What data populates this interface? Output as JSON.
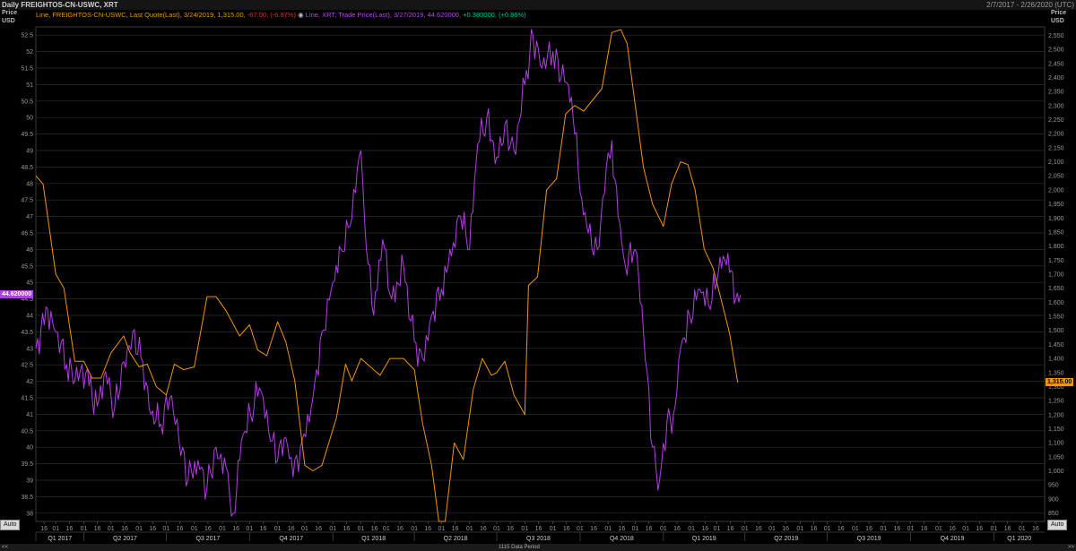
{
  "header": {
    "title": "Daily FREIGHTOS-CN-USWC, XRT",
    "date_range": "2/7/2017 - 2/26/2020 (UTC)"
  },
  "legend": {
    "series1": {
      "prefix": "Line, FREIGHTOS-CN-USWC, Last Quote(Last),  3/24/2019,  1,315.00,",
      "change": "-67.00,  (-6.87%)"
    },
    "series2": {
      "text": "Line, XRT, Trade Price(Last),  3/27/2019,  44.620000,",
      "change": "+0.380000,  (+0.86%)"
    }
  },
  "axes": {
    "left_title": [
      "Price",
      "USD"
    ],
    "right_title": [
      "Price",
      "USD"
    ],
    "left_badge": "44.620000",
    "right_badge": "1,315.00",
    "auto_left": "Auto",
    "auto_right": "Auto"
  },
  "footer": {
    "data_period": "1115 Data Period",
    "nav_left": "<<",
    "nav_right": ">>"
  },
  "colors": {
    "xrt": "#b23ee6",
    "freight": "#f0960a",
    "background": "#000000",
    "grid": "#2e2e2e",
    "change_negative": "#e03030",
    "change_positive": "#00c8a0"
  },
  "chart_data": {
    "type": "line",
    "x_range": [
      "2017-02-07",
      "2020-02-26"
    ],
    "quarters": [
      "Q1 2017",
      "Q2 2017",
      "Q3 2017",
      "Q4 2017",
      "Q1 2018",
      "Q2 2018",
      "Q3 2018",
      "Q4 2018",
      "Q1 2019",
      "Q2 2019",
      "Q3 2019",
      "Q4 2019",
      "Q1 2020"
    ],
    "left_axis": {
      "label": "Price USD",
      "ylim": [
        37.75,
        52.75
      ],
      "ticks": [
        "38",
        "38.5",
        "39",
        "39.5",
        "40",
        "40.5",
        "41",
        "41.5",
        "42",
        "42.5",
        "43",
        "43.5",
        "44",
        "44.5",
        "45",
        "45.5",
        "46",
        "46.5",
        "47",
        "47.5",
        "48",
        "48.5",
        "49",
        "49.5",
        "50",
        "50.5",
        "51",
        "51.5",
        "52",
        "52.5"
      ]
    },
    "right_axis": {
      "label": "Price USD",
      "ylim": [
        820,
        2580
      ],
      "ticks": [
        "850",
        "900",
        "950",
        "1,000",
        "1,050",
        "1,100",
        "1,150",
        "1,200",
        "1,250",
        "1,300",
        "1,350",
        "1,400",
        "1,450",
        "1,500",
        "1,550",
        "1,600",
        "1,650",
        "1,700",
        "1,750",
        "1,800",
        "1,850",
        "1,900",
        "1,950",
        "2,000",
        "2,050",
        "2,100",
        "2,150",
        "2,200",
        "2,250",
        "2,300",
        "2,350",
        "2,400",
        "2,450",
        "2,500",
        "2,550"
      ]
    },
    "series": [
      {
        "name": "XRT",
        "axis": "left",
        "points": [
          [
            "2017-02-07",
            43.0
          ],
          [
            "2017-02-20",
            44.2
          ],
          [
            "2017-03-01",
            43.5
          ],
          [
            "2017-03-13",
            42.5
          ],
          [
            "2017-03-22",
            42.0
          ],
          [
            "2017-04-05",
            42.4
          ],
          [
            "2017-04-12",
            41.0
          ],
          [
            "2017-04-25",
            42.3
          ],
          [
            "2017-05-05",
            41.2
          ],
          [
            "2017-05-15",
            42.6
          ],
          [
            "2017-05-25",
            43.5
          ],
          [
            "2017-06-05",
            42.6
          ],
          [
            "2017-06-14",
            41.0
          ],
          [
            "2017-06-25",
            40.7
          ],
          [
            "2017-07-05",
            41.5
          ],
          [
            "2017-07-15",
            40.2
          ],
          [
            "2017-07-25",
            39.0
          ],
          [
            "2017-08-05",
            39.6
          ],
          [
            "2017-08-15",
            38.8
          ],
          [
            "2017-08-25",
            40.0
          ],
          [
            "2017-09-05",
            39.4
          ],
          [
            "2017-09-13",
            38.0
          ],
          [
            "2017-09-22",
            40.2
          ],
          [
            "2017-10-02",
            41.0
          ],
          [
            "2017-10-12",
            41.8
          ],
          [
            "2017-10-22",
            40.5
          ],
          [
            "2017-11-01",
            39.6
          ],
          [
            "2017-11-10",
            40.3
          ],
          [
            "2017-11-18",
            39.1
          ],
          [
            "2017-11-28",
            40.2
          ],
          [
            "2017-12-10",
            41.5
          ],
          [
            "2017-12-20",
            43.5
          ],
          [
            "2018-01-01",
            45.0
          ],
          [
            "2018-01-10",
            46.0
          ],
          [
            "2018-01-20",
            46.7
          ],
          [
            "2018-02-01",
            49.0
          ],
          [
            "2018-02-07",
            46.0
          ],
          [
            "2018-02-15",
            44.0
          ],
          [
            "2018-02-25",
            46.3
          ],
          [
            "2018-03-07",
            44.5
          ],
          [
            "2018-03-20",
            45.5
          ],
          [
            "2018-04-01",
            43.2
          ],
          [
            "2018-04-10",
            42.7
          ],
          [
            "2018-04-20",
            44.0
          ],
          [
            "2018-05-01",
            44.8
          ],
          [
            "2018-05-12",
            45.8
          ],
          [
            "2018-05-22",
            47.0
          ],
          [
            "2018-06-01",
            46.0
          ],
          [
            "2018-06-10",
            49.2
          ],
          [
            "2018-06-20",
            50.0
          ],
          [
            "2018-07-01",
            48.8
          ],
          [
            "2018-07-10",
            49.8
          ],
          [
            "2018-07-20",
            49.0
          ],
          [
            "2018-08-01",
            51.0
          ],
          [
            "2018-08-10",
            52.5
          ],
          [
            "2018-08-20",
            51.5
          ],
          [
            "2018-09-01",
            52.0
          ],
          [
            "2018-09-10",
            51.2
          ],
          [
            "2018-09-18",
            51.0
          ],
          [
            "2018-09-25",
            49.5
          ],
          [
            "2018-10-03",
            47.5
          ],
          [
            "2018-10-10",
            46.5
          ],
          [
            "2018-10-20",
            46.0
          ],
          [
            "2018-10-30",
            48.5
          ],
          [
            "2018-11-05",
            49.3
          ],
          [
            "2018-11-12",
            47.0
          ],
          [
            "2018-11-20",
            45.5
          ],
          [
            "2018-12-01",
            46.0
          ],
          [
            "2018-12-10",
            43.5
          ],
          [
            "2018-12-20",
            40.0
          ],
          [
            "2018-12-26",
            38.7
          ],
          [
            "2019-01-05",
            40.8
          ],
          [
            "2019-01-12",
            41.0
          ],
          [
            "2019-01-20",
            43.0
          ],
          [
            "2019-01-30",
            44.0
          ],
          [
            "2019-02-10",
            44.8
          ],
          [
            "2019-02-20",
            44.3
          ],
          [
            "2019-03-01",
            45.0
          ],
          [
            "2019-03-08",
            45.8
          ],
          [
            "2019-03-15",
            45.3
          ],
          [
            "2019-03-22",
            44.5
          ],
          [
            "2019-03-27",
            44.62
          ]
        ]
      },
      {
        "name": "FREIGHTOS-CN-USWC",
        "axis": "right",
        "points": [
          [
            "2017-02-07",
            2050
          ],
          [
            "2017-02-15",
            2020
          ],
          [
            "2017-03-01",
            1700
          ],
          [
            "2017-03-10",
            1650
          ],
          [
            "2017-03-22",
            1390
          ],
          [
            "2017-04-01",
            1390
          ],
          [
            "2017-04-10",
            1330
          ],
          [
            "2017-04-20",
            1330
          ],
          [
            "2017-05-01",
            1420
          ],
          [
            "2017-05-15",
            1480
          ],
          [
            "2017-05-22",
            1420
          ],
          [
            "2017-06-01",
            1370
          ],
          [
            "2017-06-10",
            1380
          ],
          [
            "2017-06-20",
            1300
          ],
          [
            "2017-07-01",
            1270
          ],
          [
            "2017-07-10",
            1380
          ],
          [
            "2017-07-20",
            1360
          ],
          [
            "2017-08-01",
            1370
          ],
          [
            "2017-08-15",
            1620
          ],
          [
            "2017-08-25",
            1620
          ],
          [
            "2017-09-05",
            1570
          ],
          [
            "2017-09-20",
            1480
          ],
          [
            "2017-10-01",
            1520
          ],
          [
            "2017-10-10",
            1430
          ],
          [
            "2017-10-20",
            1410
          ],
          [
            "2017-11-01",
            1530
          ],
          [
            "2017-11-10",
            1460
          ],
          [
            "2017-11-20",
            1320
          ],
          [
            "2017-12-01",
            1020
          ],
          [
            "2017-12-10",
            1000
          ],
          [
            "2017-12-20",
            1020
          ],
          [
            "2018-01-05",
            1190
          ],
          [
            "2018-01-15",
            1380
          ],
          [
            "2018-01-22",
            1320
          ],
          [
            "2018-02-01",
            1400
          ],
          [
            "2018-02-15",
            1360
          ],
          [
            "2018-02-22",
            1340
          ],
          [
            "2018-03-05",
            1400
          ],
          [
            "2018-03-20",
            1400
          ],
          [
            "2018-04-01",
            1360
          ],
          [
            "2018-04-10",
            1170
          ],
          [
            "2018-04-20",
            1020
          ],
          [
            "2018-04-28",
            820
          ],
          [
            "2018-05-05",
            820
          ],
          [
            "2018-05-15",
            1100
          ],
          [
            "2018-05-25",
            1040
          ],
          [
            "2018-06-05",
            1290
          ],
          [
            "2018-06-15",
            1400
          ],
          [
            "2018-06-25",
            1340
          ],
          [
            "2018-07-01",
            1350
          ],
          [
            "2018-07-10",
            1390
          ],
          [
            "2018-07-20",
            1270
          ],
          [
            "2018-08-01",
            1200
          ],
          [
            "2018-08-05",
            1660
          ],
          [
            "2018-08-15",
            1690
          ],
          [
            "2018-08-25",
            2000
          ],
          [
            "2018-09-05",
            2040
          ],
          [
            "2018-09-15",
            2270
          ],
          [
            "2018-09-25",
            2300
          ],
          [
            "2018-10-05",
            2280
          ],
          [
            "2018-10-15",
            2320
          ],
          [
            "2018-10-25",
            2360
          ],
          [
            "2018-11-05",
            2560
          ],
          [
            "2018-11-15",
            2570
          ],
          [
            "2018-11-22",
            2520
          ],
          [
            "2018-12-01",
            2300
          ],
          [
            "2018-12-10",
            2080
          ],
          [
            "2018-12-20",
            1950
          ],
          [
            "2019-01-01",
            1870
          ],
          [
            "2019-01-10",
            2020
          ],
          [
            "2019-01-20",
            2100
          ],
          [
            "2019-01-28",
            2090
          ],
          [
            "2019-02-05",
            2000
          ],
          [
            "2019-02-15",
            1790
          ],
          [
            "2019-02-25",
            1720
          ],
          [
            "2019-03-05",
            1620
          ],
          [
            "2019-03-15",
            1490
          ],
          [
            "2019-03-24",
            1315
          ]
        ]
      }
    ]
  }
}
